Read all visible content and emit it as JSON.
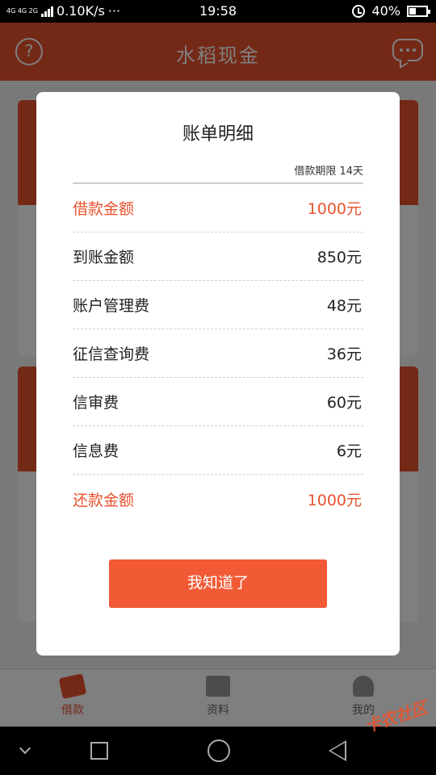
{
  "status_bar": {
    "network": "4G 4G 2G",
    "speed": "0.10K/s",
    "more": "···",
    "time": "19:58",
    "battery": "40%"
  },
  "app": {
    "title": "水稻现金",
    "help_icon": "question-circle-icon",
    "message_icon": "chat-bubble-icon"
  },
  "tabs": [
    {
      "label": "借款",
      "icon": "loan-icon",
      "active": true
    },
    {
      "label": "资料",
      "icon": "id-card-icon",
      "active": false
    },
    {
      "label": "我的",
      "icon": "person-icon",
      "active": false
    }
  ],
  "modal": {
    "title": "账单明细",
    "term": "借款期限 14天",
    "rows": [
      {
        "label": "借款金额",
        "value": "1000元",
        "highlight": true
      },
      {
        "label": "到账金额",
        "value": "850元",
        "highlight": false
      },
      {
        "label": "账户管理费",
        "value": "48元",
        "highlight": false
      },
      {
        "label": "征信查询费",
        "value": "36元",
        "highlight": false
      },
      {
        "label": "信审费",
        "value": "60元",
        "highlight": false
      },
      {
        "label": "信息费",
        "value": "6元",
        "highlight": false
      },
      {
        "label": "还款金额",
        "value": "1000元",
        "highlight": true
      }
    ],
    "confirm_label": "我知道了"
  },
  "watermark": "卡农社区",
  "colors": {
    "brand": "#e8532f",
    "button": "#f15a35"
  }
}
